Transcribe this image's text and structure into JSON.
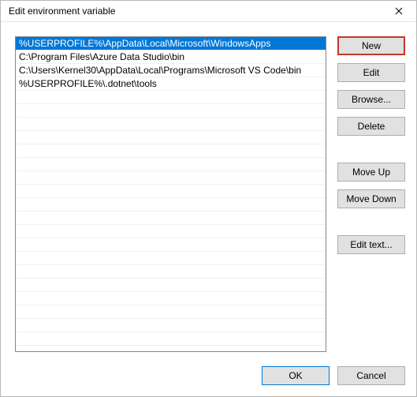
{
  "titlebar": {
    "title": "Edit environment variable"
  },
  "paths": [
    "%USERPROFILE%\\AppData\\Local\\Microsoft\\WindowsApps",
    "C:\\Program Files\\Azure Data Studio\\bin",
    "C:\\Users\\Kernel30\\AppData\\Local\\Programs\\Microsoft VS Code\\bin",
    "%USERPROFILE%\\.dotnet\\tools"
  ],
  "selected_index": 0,
  "buttons": {
    "new": "New",
    "edit": "Edit",
    "browse": "Browse...",
    "delete": "Delete",
    "move_up": "Move Up",
    "move_down": "Move Down",
    "edit_text": "Edit text...",
    "ok": "OK",
    "cancel": "Cancel"
  }
}
